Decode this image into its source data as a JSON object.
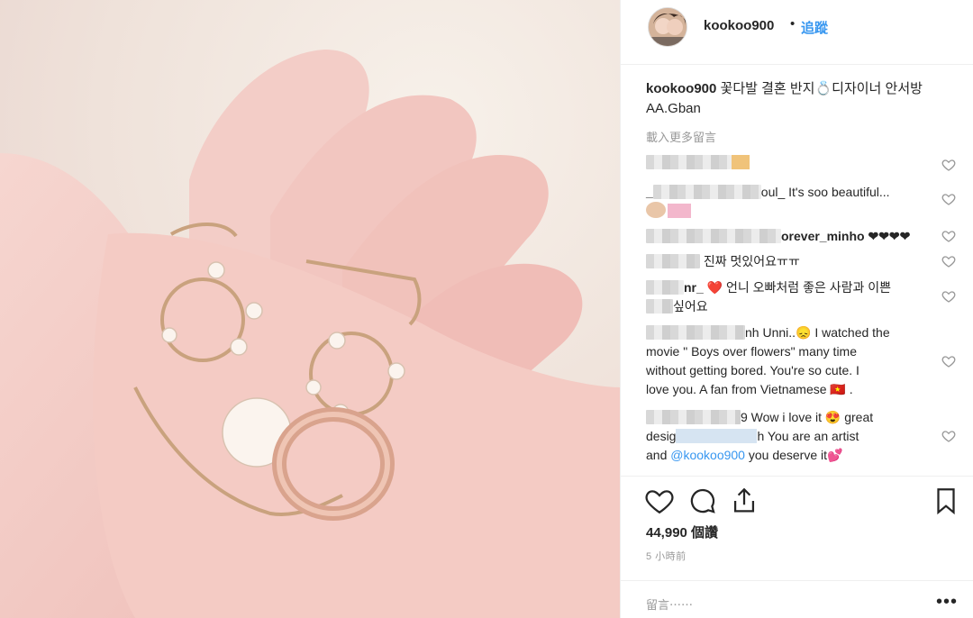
{
  "post": {
    "username": "kookoo900",
    "dot": "•",
    "follow_label": "追蹤",
    "caption_text": "꽃다발 결혼 반지💍디자이너 안서방 AA.Gban",
    "load_more": "載入更多留言",
    "likes": "44,990 個讚",
    "timestamp": "5 小時前",
    "add_comment_placeholder": "留言⋯⋯",
    "options_label": "•••"
  },
  "comments": [
    {
      "user_visible": "",
      "text": ""
    },
    {
      "user_visible": "_",
      "text": "oul_ It's soo beautiful..."
    },
    {
      "user_visible": "",
      "text": "orever_minho ❤❤❤❤"
    },
    {
      "user_visible": "",
      "text": "진짜 멋있어요ㅠㅠ"
    },
    {
      "user_visible": "nr_",
      "text": "❤️ 언니 오빠처럼 좋은 사람과 이쁜",
      "text2": "싶어요"
    },
    {
      "user_visible": "",
      "text": "nh Unni..😞 I watched the",
      "text2": "movie \" Boys over flowers\" many time",
      "text3": "without getting bored. You're so cute. I",
      "text4": "love you. A fan from Vietnamese 🇻🇳 ."
    },
    {
      "user_visible": "",
      "text": "9 Wow i love it 😍 great",
      "text2a": "desig",
      "text2b": "h You are an artist",
      "text3a": "and ",
      "mention": "@kookoo900",
      "text3b": " you deserve it💕"
    }
  ],
  "icons": {
    "heart": "heart-icon",
    "comment": "comment-icon",
    "share": "share-icon",
    "bookmark": "bookmark-icon"
  },
  "colors": {
    "link_blue": "#3897f0",
    "text": "#262626",
    "muted": "#999999"
  }
}
